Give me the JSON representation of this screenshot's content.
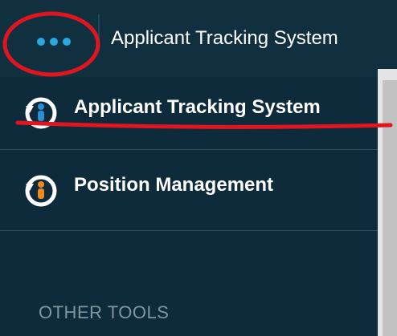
{
  "header": {
    "menu_icon": "more-horizontal-icon",
    "title": "Applicant Tracking System"
  },
  "nav": {
    "items": [
      {
        "label": "Applicant Tracking System",
        "icon": "app-switch-icon",
        "accent": "#2a8fd6"
      },
      {
        "label": "Position Management",
        "icon": "app-switch-icon",
        "accent": "#f08a1c"
      }
    ],
    "section_header": "OTHER TOOLS"
  },
  "colors": {
    "background": "#0f2e3e",
    "menu_dots": "#29a8e0",
    "annotation": "#e0151f"
  }
}
